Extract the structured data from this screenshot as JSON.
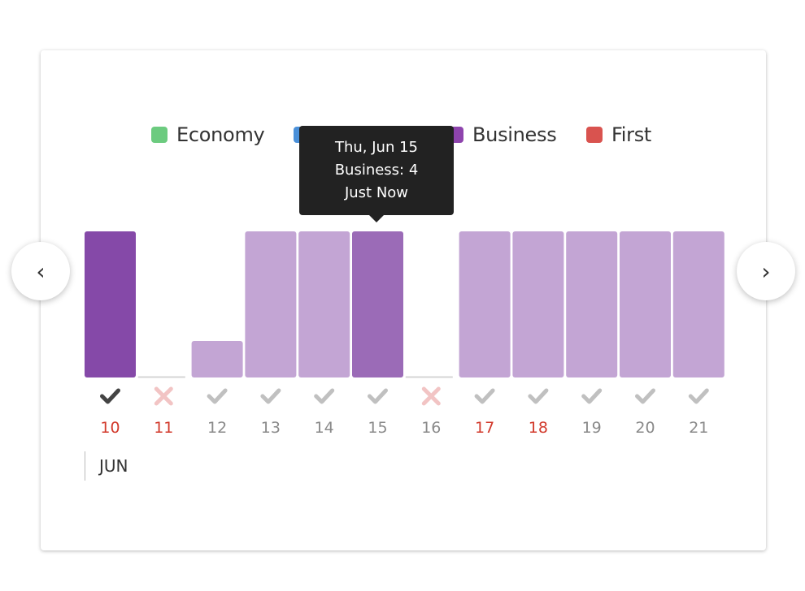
{
  "legend": [
    {
      "label": "Economy",
      "color": "#6ccb7f"
    },
    {
      "label": "",
      "color": "#4a90d9"
    },
    {
      "label": "Business",
      "color": "#8e44ad"
    },
    {
      "label": "First",
      "color": "#d9534f"
    }
  ],
  "tooltip": {
    "date": "Thu, Jun 15",
    "value_line": "Business: 4",
    "time": "Just Now"
  },
  "nav": {
    "prev_icon": "chevron-left-icon",
    "next_icon": "chevron-right-icon",
    "prev_glyph": "‹",
    "next_glyph": "›"
  },
  "month_label": "JUN",
  "colors": {
    "bar_selected": "#8549a8",
    "bar_hover": "#9b6bb7",
    "bar_default": "#c3a5d4",
    "status_ok_active": "#444444",
    "status_ok": "#c0c0c0",
    "status_fail": "#f2c4c4",
    "day_red": "#d23a2c",
    "day_gray": "#8a8a8a"
  },
  "chart_data": {
    "type": "bar",
    "categories": [
      "10",
      "11",
      "12",
      "13",
      "14",
      "15",
      "16",
      "17",
      "18",
      "19",
      "20",
      "21"
    ],
    "series": [
      {
        "name": "Business",
        "values": [
          4,
          0,
          1,
          4,
          4,
          4,
          0,
          4,
          4,
          4,
          4,
          4
        ]
      }
    ],
    "ylim": [
      0,
      4
    ],
    "bar_state": [
      "selected",
      "empty",
      "default",
      "default",
      "default",
      "hover",
      "empty",
      "default",
      "default",
      "default",
      "default",
      "default"
    ],
    "status": [
      "ok-active",
      "fail",
      "ok",
      "ok",
      "ok",
      "ok",
      "fail",
      "ok",
      "ok",
      "ok",
      "ok",
      "ok"
    ],
    "day_color": [
      "red",
      "red",
      "gray",
      "gray",
      "gray",
      "gray",
      "gray",
      "red",
      "red",
      "gray",
      "gray",
      "gray"
    ]
  }
}
